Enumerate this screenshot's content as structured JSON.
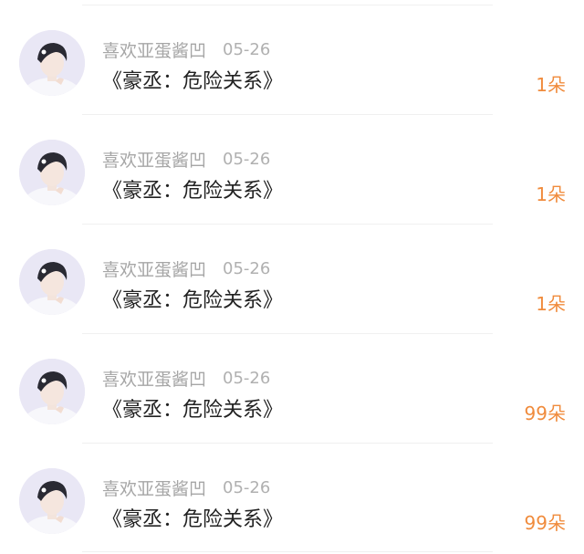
{
  "list": {
    "items": [
      {
        "username": "喜欢亚蛋酱凹",
        "date": "05-26",
        "title": "《豪丞：危险关系》",
        "count": "1朵"
      },
      {
        "username": "喜欢亚蛋酱凹",
        "date": "05-26",
        "title": "《豪丞：危险关系》",
        "count": "1朵"
      },
      {
        "username": "喜欢亚蛋酱凹",
        "date": "05-26",
        "title": "《豪丞：危险关系》",
        "count": "1朵"
      },
      {
        "username": "喜欢亚蛋酱凹",
        "date": "05-26",
        "title": "《豪丞：危险关系》",
        "count": "99朵"
      },
      {
        "username": "喜欢亚蛋酱凹",
        "date": "05-26",
        "title": "《豪丞：危险关系》",
        "count": "99朵"
      }
    ]
  },
  "colors": {
    "count_accent": "#f08b3c",
    "secondary_text": "#a6a6a6",
    "primary_text": "#222222"
  },
  "icons": {
    "avatar": "user-avatar-photo"
  }
}
